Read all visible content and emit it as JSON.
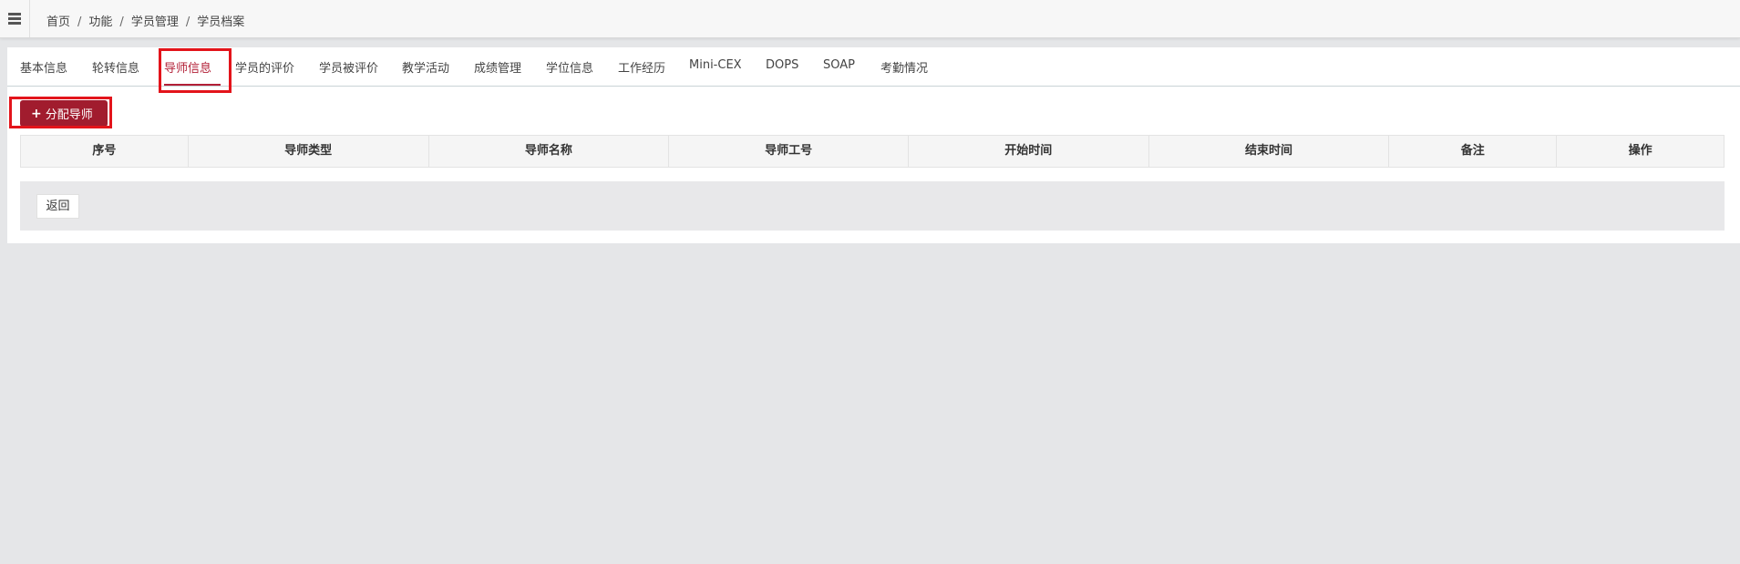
{
  "breadcrumb": {
    "items": [
      "首页",
      "功能",
      "学员管理",
      "学员档案"
    ],
    "separator": "/"
  },
  "tabs": [
    {
      "label": "基本信息",
      "active": false
    },
    {
      "label": "轮转信息",
      "active": false
    },
    {
      "label": "导师信息",
      "active": true
    },
    {
      "label": "学员的评价",
      "active": false
    },
    {
      "label": "学员被评价",
      "active": false
    },
    {
      "label": "教学活动",
      "active": false
    },
    {
      "label": "成绩管理",
      "active": false
    },
    {
      "label": "学位信息",
      "active": false
    },
    {
      "label": "工作经历",
      "active": false
    },
    {
      "label": "Mini-CEX",
      "active": false
    },
    {
      "label": "DOPS",
      "active": false
    },
    {
      "label": "SOAP",
      "active": false
    },
    {
      "label": "考勤情况",
      "active": false
    }
  ],
  "toolbar": {
    "add_label": "分配导师",
    "add_icon": "plus-icon"
  },
  "table": {
    "columns": [
      "序号",
      "导师类型",
      "导师名称",
      "导师工号",
      "开始时间",
      "结束时间",
      "备注",
      "操作"
    ],
    "rows": []
  },
  "footer": {
    "back_label": "返回"
  },
  "colors": {
    "accent": "#a11c2e",
    "active_tab": "#b21f36",
    "highlight_box": "#e3141b",
    "page_bg": "#e5e6e8"
  }
}
